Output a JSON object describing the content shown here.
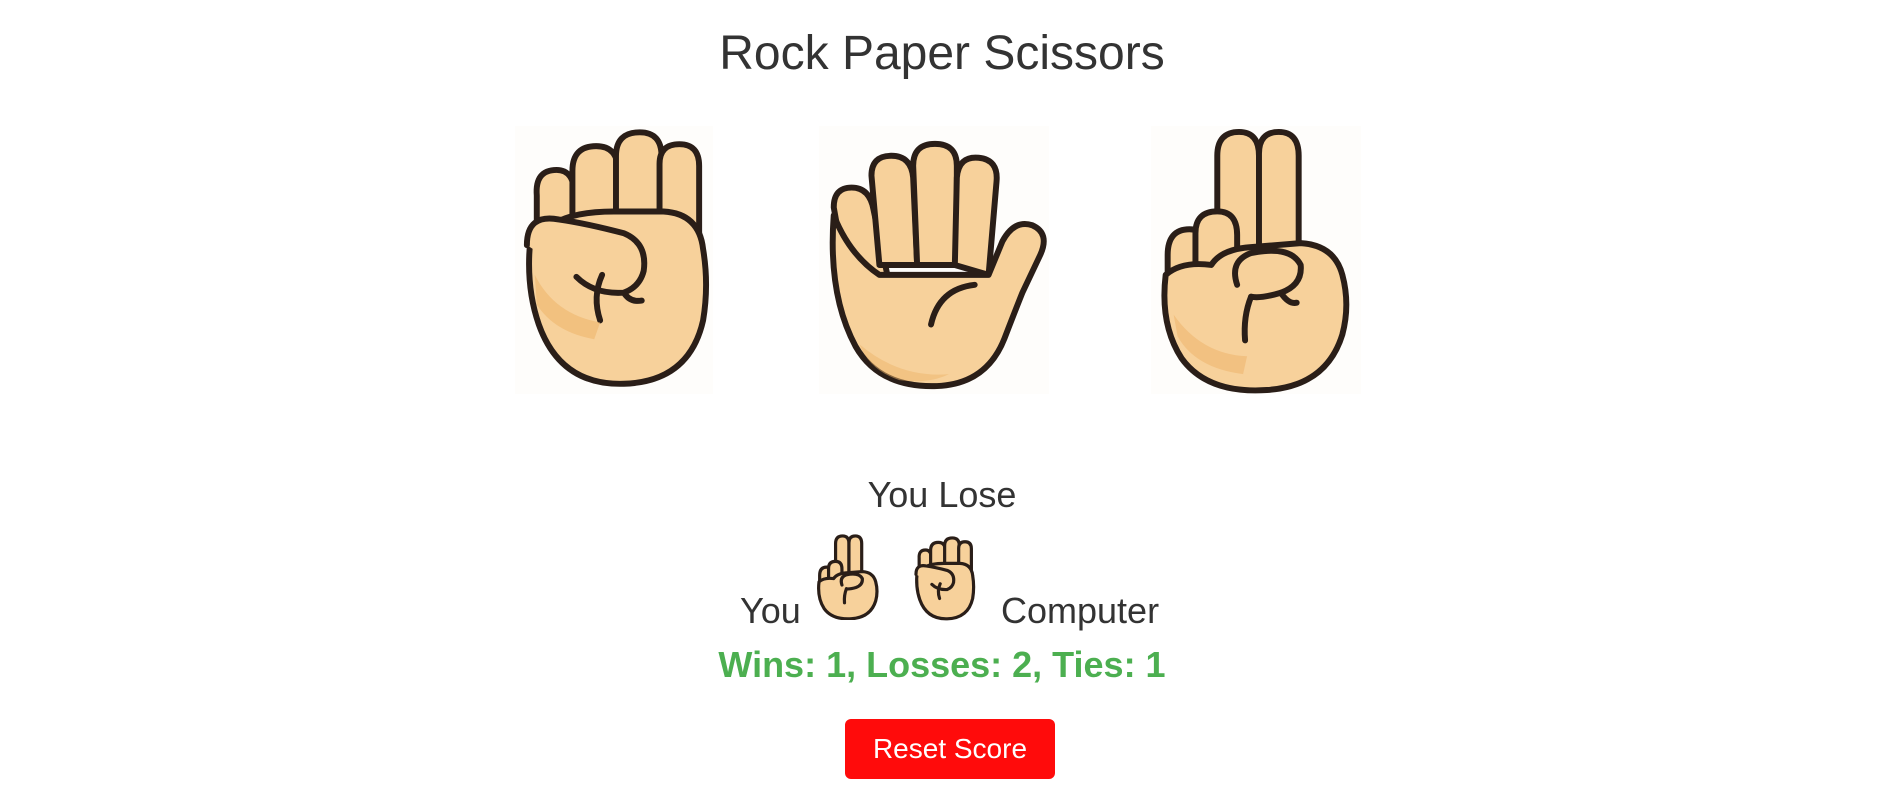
{
  "header": {
    "title": "Rock Paper Scissors"
  },
  "moves": [
    {
      "name": "rock",
      "icon": "rock-fist-icon"
    },
    {
      "name": "paper",
      "icon": "open-hand-icon"
    },
    {
      "name": "scissors",
      "icon": "victory-hand-icon"
    }
  ],
  "result": {
    "text": "You Lose",
    "you_label": "You",
    "computer_label": "Computer",
    "player_move_icon": "victory-hand-icon",
    "computer_move_icon": "rock-fist-icon"
  },
  "score": {
    "text": "Wins: 1, Losses: 2, Ties: 1",
    "color": "#4caf50"
  },
  "reset": {
    "label": "Reset Score",
    "color": "#ff0b0b"
  },
  "colors": {
    "skin": "#f7d19b",
    "skin_shadow": "#eeb56c",
    "outline": "#2a1e18"
  }
}
